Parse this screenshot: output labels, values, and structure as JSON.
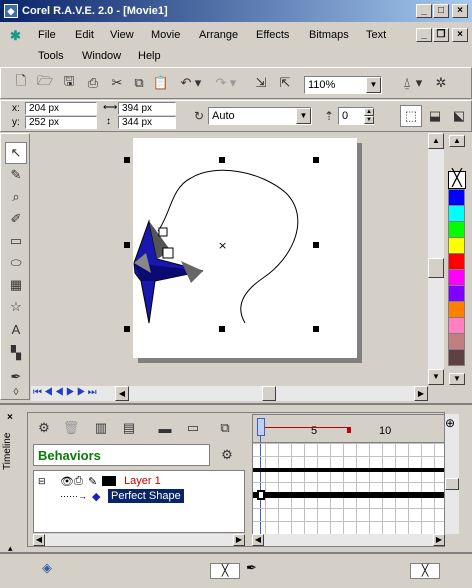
{
  "window": {
    "title": "Corel R.A.V.E. 2.0 - [Movie1]"
  },
  "menu": {
    "items": [
      "File",
      "Edit",
      "View",
      "Movie",
      "Arrange",
      "Effects",
      "Bitmaps",
      "Text",
      "Tools",
      "Window",
      "Help"
    ]
  },
  "toolbar": {
    "zoom": "110%"
  },
  "property_bar": {
    "x": "x:",
    "x_value": "204 px",
    "y": "y:",
    "y_value": "252 px",
    "width": "394 px",
    "height": "344 px",
    "mode": "Auto",
    "angle": "0"
  },
  "palette": {
    "colors": [
      "#ffffff",
      "#000000",
      "#0000ff",
      "#00ffff",
      "#00ff00",
      "#ffff00",
      "#ff0000",
      "#ff00ff",
      "#8000ff",
      "#ff8000",
      "#ff80c0",
      "#c08080",
      "#604040"
    ]
  },
  "timeline": {
    "title": "Timeline",
    "behaviors_label": "Behaviors",
    "frame_marks": [
      "5",
      "10"
    ],
    "layers": [
      {
        "name": "Layer 1",
        "color": "#c00000"
      },
      {
        "name": "Perfect Shape",
        "selected": true
      }
    ]
  }
}
